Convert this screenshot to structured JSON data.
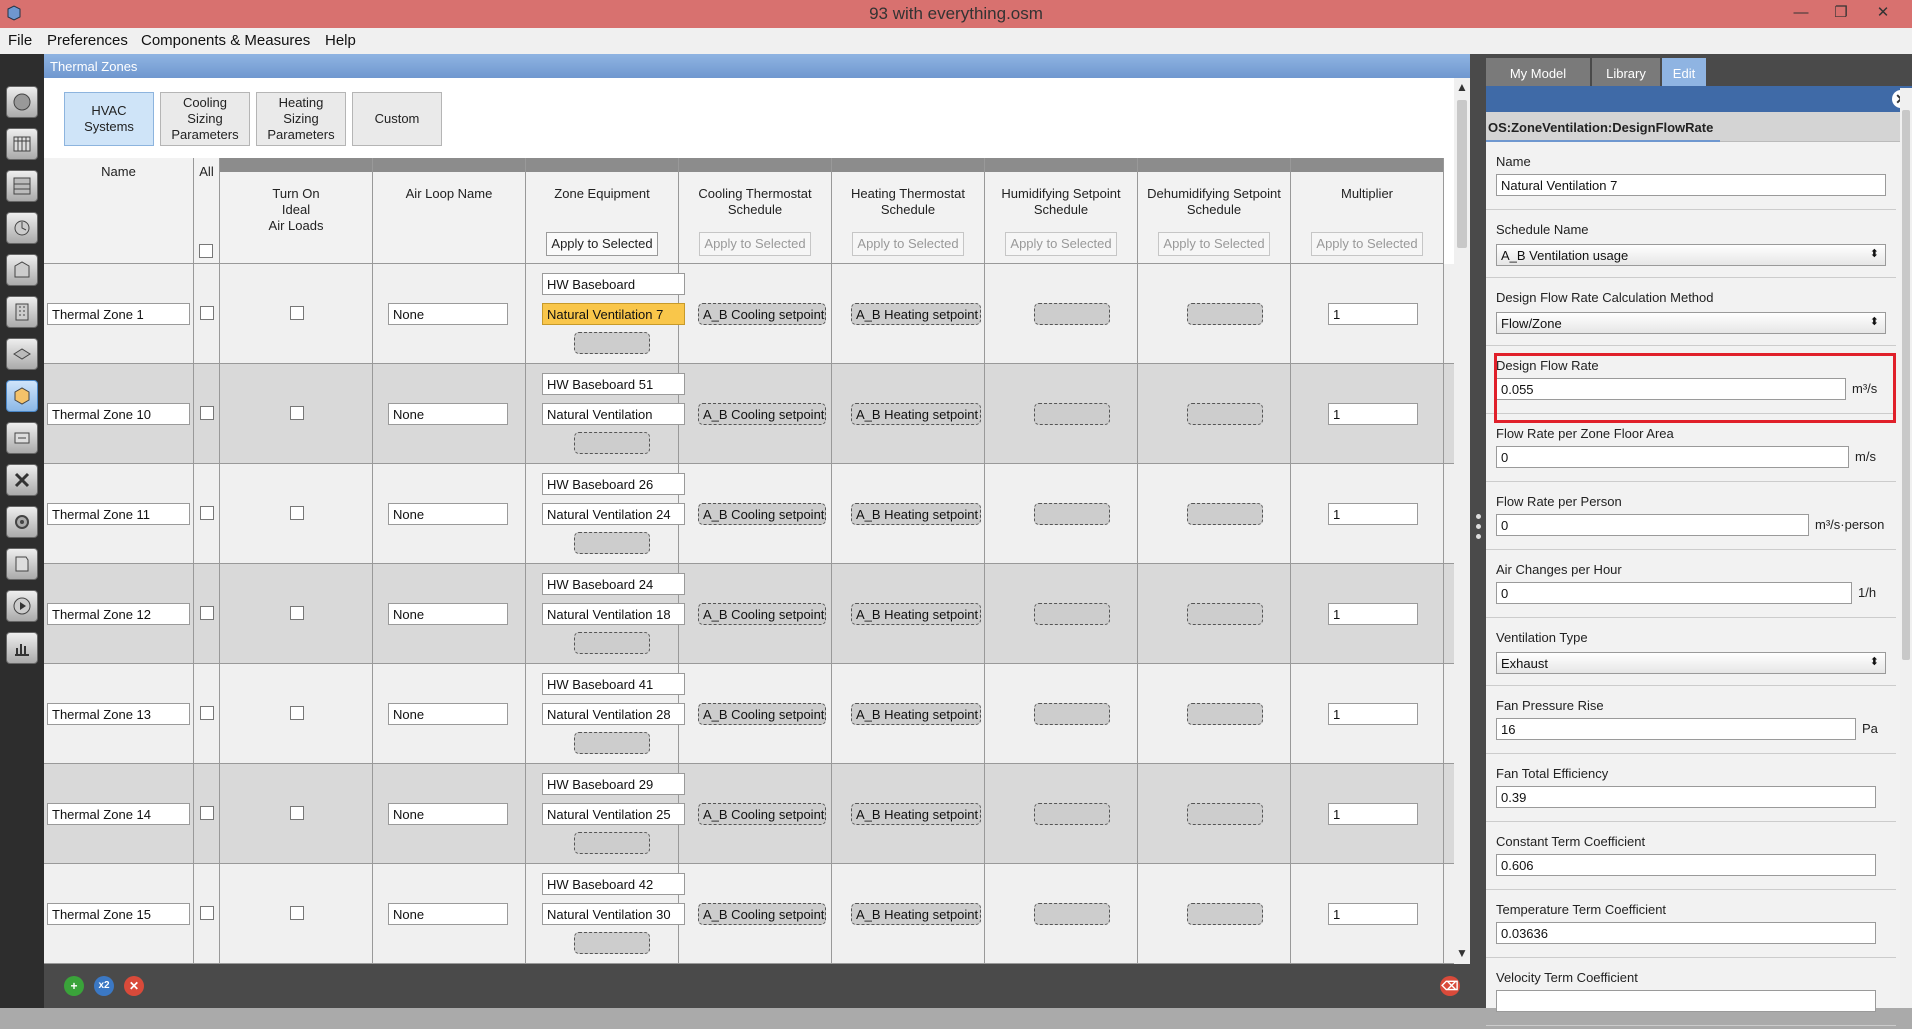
{
  "window": {
    "title": "93 with everything.osm",
    "minimize": "—",
    "maximize": "❐",
    "close": "✕"
  },
  "menu": [
    "File",
    "Preferences",
    "Components & Measures",
    "Help"
  ],
  "sidebar_icons": [
    "site-icon",
    "schedules-icon",
    "constructions-icon",
    "loads-icon",
    "space-types-icon",
    "geometry-icon",
    "facility-icon",
    "spaces-icon",
    "thermal-zones-icon",
    "hvac-systems-icon",
    "variables-icon",
    "simulation-settings-icon",
    "scripts-icon",
    "run-icon",
    "results-icon"
  ],
  "panel_title": "Thermal Zones",
  "subtabs": [
    {
      "label": "HVAC\nSystems",
      "active": true
    },
    {
      "label": "Cooling\nSizing\nParameters",
      "active": false
    },
    {
      "label": "Heating\nSizing\nParameters",
      "active": false
    },
    {
      "label": "Custom",
      "active": false
    }
  ],
  "columns": {
    "name": "Name",
    "all": "All",
    "ideal_loads": "Turn On\nIdeal\nAir Loads",
    "air_loop": "Air Loop Name",
    "zone_equipment": "Zone Equipment",
    "cooling": "Cooling Thermostat\nSchedule",
    "heating": "Heating Thermostat\nSchedule",
    "humidifying": "Humidifying Setpoint\nSchedule",
    "dehumidifying": "Dehumidifying Setpoint\nSchedule",
    "multiplier": "Multiplier"
  },
  "apply_label": "Apply to Selected",
  "rows": [
    {
      "name": "Thermal Zone 1",
      "air_loop": "None",
      "equip1": "HW Baseboard",
      "equip2": "Natural Ventilation 7",
      "cooling": "A_B Cooling setpoint",
      "heating": "A_B Heating setpoint",
      "multiplier": "1",
      "selected_equip": true
    },
    {
      "name": "Thermal Zone 10",
      "air_loop": "None",
      "equip1": "HW Baseboard 51",
      "equip2": "Natural Ventilation",
      "cooling": "A_B Cooling setpoint",
      "heating": "A_B Heating setpoint",
      "multiplier": "1"
    },
    {
      "name": "Thermal Zone 11",
      "air_loop": "None",
      "equip1": "HW Baseboard 26",
      "equip2": "Natural Ventilation 24",
      "cooling": "A_B Cooling setpoint",
      "heating": "A_B Heating setpoint",
      "multiplier": "1"
    },
    {
      "name": "Thermal Zone 12",
      "air_loop": "None",
      "equip1": "HW Baseboard 24",
      "equip2": "Natural Ventilation 18",
      "cooling": "A_B Cooling setpoint",
      "heating": "A_B Heating setpoint",
      "multiplier": "1"
    },
    {
      "name": "Thermal Zone 13",
      "air_loop": "None",
      "equip1": "HW Baseboard 41",
      "equip2": "Natural Ventilation 28",
      "cooling": "A_B Cooling setpoint",
      "heating": "A_B Heating setpoint",
      "multiplier": "1"
    },
    {
      "name": "Thermal Zone 14",
      "air_loop": "None",
      "equip1": "HW Baseboard 29",
      "equip2": "Natural Ventilation 25",
      "cooling": "A_B Cooling setpoint",
      "heating": "A_B Heating setpoint",
      "multiplier": "1"
    },
    {
      "name": "Thermal Zone 15",
      "air_loop": "None",
      "equip1": "HW Baseboard 42",
      "equip2": "Natural Ventilation 30",
      "cooling": "A_B Cooling setpoint",
      "heating": "A_B Heating setpoint",
      "multiplier": "1"
    }
  ],
  "right_tabs": [
    "My Model",
    "Library",
    "Edit"
  ],
  "inspector_class": "OS:ZoneVentilation:DesignFlowRate",
  "inspector_fields": [
    {
      "label": "Name",
      "value": "Natural Ventilation 7",
      "unit": ""
    },
    {
      "label": "Schedule Name",
      "value": "A_B Ventilation usage",
      "unit": "",
      "select": true
    },
    {
      "label": "Design Flow Rate Calculation Method",
      "value": "Flow/Zone",
      "unit": "",
      "select": true
    },
    {
      "label": "Design Flow Rate",
      "value": "0.055",
      "unit": "m³/s"
    },
    {
      "label": "Flow Rate per Zone Floor Area",
      "value": "0",
      "unit": "m/s"
    },
    {
      "label": "Flow Rate per Person",
      "value": "0",
      "unit": "m³/s·person"
    },
    {
      "label": "Air Changes per Hour",
      "value": "0",
      "unit": "1/h"
    },
    {
      "label": "Ventilation Type",
      "value": "Exhaust",
      "unit": "",
      "select": true
    },
    {
      "label": "Fan Pressure Rise",
      "value": "16",
      "unit": "Pa"
    },
    {
      "label": "Fan Total Efficiency",
      "value": "0.39",
      "unit": ""
    },
    {
      "label": "Constant Term Coefficient",
      "value": "0.606",
      "unit": ""
    },
    {
      "label": "Temperature Term Coefficient",
      "value": "0.03636",
      "unit": ""
    },
    {
      "label": "Velocity Term Coefficient",
      "value": "",
      "unit": ""
    }
  ],
  "bottom_buttons": [
    "add-icon",
    "copy-icon",
    "remove-icon",
    "purge-icon"
  ],
  "copy_label": "x2",
  "colors": {
    "titlebar": "#d8716f",
    "accent": "#6f97cf",
    "selected": "#f9c64a",
    "highlight": "#e0202a"
  }
}
